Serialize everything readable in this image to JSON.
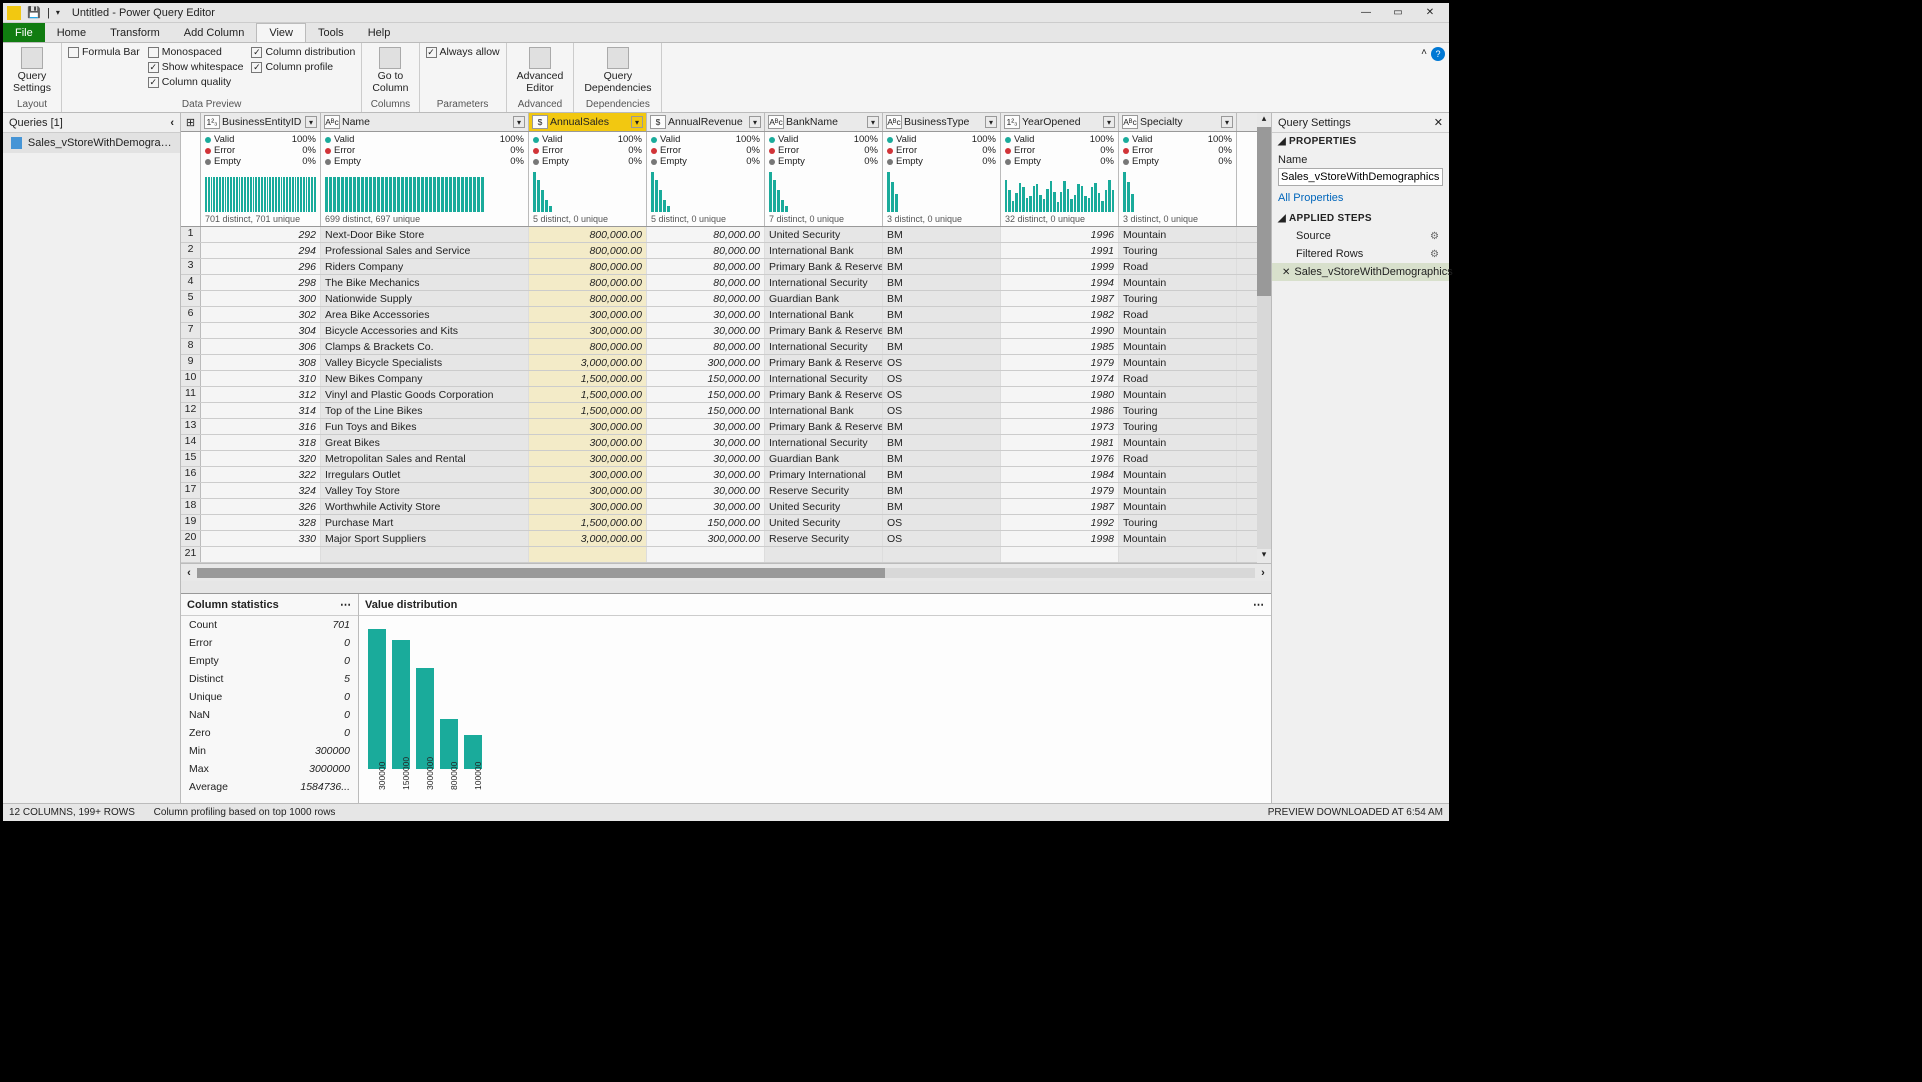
{
  "window": {
    "title": "Untitled - Power Query Editor"
  },
  "menutabs": [
    "File",
    "Home",
    "Transform",
    "Add Column",
    "View",
    "Tools",
    "Help"
  ],
  "menutab_active": "View",
  "ribbon": {
    "query_settings": "Query\nSettings",
    "layout_label": "Layout",
    "formula_bar": "Formula Bar",
    "monospaced": "Monospaced",
    "show_whitespace": "Show whitespace",
    "column_quality": "Column quality",
    "column_distribution": "Column distribution",
    "column_profile": "Column profile",
    "data_preview_label": "Data Preview",
    "goto_column": "Go to\nColumn",
    "columns_label": "Columns",
    "always_allow": "Always allow",
    "parameters_label": "Parameters",
    "advanced_editor": "Advanced\nEditor",
    "advanced_label": "Advanced",
    "query_dependencies": "Query\nDependencies",
    "dependencies_label": "Dependencies"
  },
  "queries": {
    "header": "Queries [1]",
    "items": [
      "Sales_vStoreWithDemographics"
    ]
  },
  "columns": [
    {
      "name": "BusinessEntityID",
      "type": "1²₃",
      "distinct": "701 distinct, 701 unique",
      "spark": "flat"
    },
    {
      "name": "Name",
      "type": "Aᴮc",
      "distinct": "699 distinct, 697 unique",
      "spark": "flat"
    },
    {
      "name": "AnnualSales",
      "type": "$",
      "distinct": "5 distinct, 0 unique",
      "spark": "desc",
      "selected": true
    },
    {
      "name": "AnnualRevenue",
      "type": "$",
      "distinct": "5 distinct, 0 unique",
      "spark": "desc"
    },
    {
      "name": "BankName",
      "type": "Aᴮc",
      "distinct": "7 distinct, 0 unique",
      "spark": "desc"
    },
    {
      "name": "BusinessType",
      "type": "Aᴮc",
      "distinct": "3 distinct, 0 unique",
      "spark": "few"
    },
    {
      "name": "YearOpened",
      "type": "1²₃",
      "distinct": "32 distinct, 0 unique",
      "spark": "spread"
    },
    {
      "name": "Specialty",
      "type": "Aᴮc",
      "distinct": "3 distinct, 0 unique",
      "spark": "few"
    }
  ],
  "profile_stats": {
    "valid": "Valid",
    "valid_pct": "100%",
    "error": "Error",
    "error_pct": "0%",
    "empty": "Empty",
    "empty_pct": "0%"
  },
  "rows": [
    {
      "n": 1,
      "id": "292",
      "name": "Next-Door Bike Store",
      "sales": "800,000.00",
      "rev": "80,000.00",
      "bank": "United Security",
      "bt": "BM",
      "yr": "1996",
      "sp": "Mountain"
    },
    {
      "n": 2,
      "id": "294",
      "name": "Professional Sales and Service",
      "sales": "800,000.00",
      "rev": "80,000.00",
      "bank": "International Bank",
      "bt": "BM",
      "yr": "1991",
      "sp": "Touring"
    },
    {
      "n": 3,
      "id": "296",
      "name": "Riders Company",
      "sales": "800,000.00",
      "rev": "80,000.00",
      "bank": "Primary Bank & Reserve",
      "bt": "BM",
      "yr": "1999",
      "sp": "Road"
    },
    {
      "n": 4,
      "id": "298",
      "name": "The Bike Mechanics",
      "sales": "800,000.00",
      "rev": "80,000.00",
      "bank": "International Security",
      "bt": "BM",
      "yr": "1994",
      "sp": "Mountain"
    },
    {
      "n": 5,
      "id": "300",
      "name": "Nationwide Supply",
      "sales": "800,000.00",
      "rev": "80,000.00",
      "bank": "Guardian Bank",
      "bt": "BM",
      "yr": "1987",
      "sp": "Touring"
    },
    {
      "n": 6,
      "id": "302",
      "name": "Area Bike Accessories",
      "sales": "300,000.00",
      "rev": "30,000.00",
      "bank": "International Bank",
      "bt": "BM",
      "yr": "1982",
      "sp": "Road"
    },
    {
      "n": 7,
      "id": "304",
      "name": "Bicycle Accessories and Kits",
      "sales": "300,000.00",
      "rev": "30,000.00",
      "bank": "Primary Bank & Reserve",
      "bt": "BM",
      "yr": "1990",
      "sp": "Mountain"
    },
    {
      "n": 8,
      "id": "306",
      "name": "Clamps & Brackets Co.",
      "sales": "800,000.00",
      "rev": "80,000.00",
      "bank": "International Security",
      "bt": "BM",
      "yr": "1985",
      "sp": "Mountain"
    },
    {
      "n": 9,
      "id": "308",
      "name": "Valley Bicycle Specialists",
      "sales": "3,000,000.00",
      "rev": "300,000.00",
      "bank": "Primary Bank & Reserve",
      "bt": "OS",
      "yr": "1979",
      "sp": "Mountain"
    },
    {
      "n": 10,
      "id": "310",
      "name": "New Bikes Company",
      "sales": "1,500,000.00",
      "rev": "150,000.00",
      "bank": "International Security",
      "bt": "OS",
      "yr": "1974",
      "sp": "Road"
    },
    {
      "n": 11,
      "id": "312",
      "name": "Vinyl and Plastic Goods Corporation",
      "sales": "1,500,000.00",
      "rev": "150,000.00",
      "bank": "Primary Bank & Reserve",
      "bt": "OS",
      "yr": "1980",
      "sp": "Mountain"
    },
    {
      "n": 12,
      "id": "314",
      "name": "Top of the Line Bikes",
      "sales": "1,500,000.00",
      "rev": "150,000.00",
      "bank": "International Bank",
      "bt": "OS",
      "yr": "1986",
      "sp": "Touring"
    },
    {
      "n": 13,
      "id": "316",
      "name": "Fun Toys and Bikes",
      "sales": "300,000.00",
      "rev": "30,000.00",
      "bank": "Primary Bank & Reserve",
      "bt": "BM",
      "yr": "1973",
      "sp": "Touring"
    },
    {
      "n": 14,
      "id": "318",
      "name": "Great Bikes",
      "sales": "300,000.00",
      "rev": "30,000.00",
      "bank": "International Security",
      "bt": "BM",
      "yr": "1981",
      "sp": "Mountain"
    },
    {
      "n": 15,
      "id": "320",
      "name": "Metropolitan Sales and Rental",
      "sales": "300,000.00",
      "rev": "30,000.00",
      "bank": "Guardian Bank",
      "bt": "BM",
      "yr": "1976",
      "sp": "Road"
    },
    {
      "n": 16,
      "id": "322",
      "name": "Irregulars Outlet",
      "sales": "300,000.00",
      "rev": "30,000.00",
      "bank": "Primary International",
      "bt": "BM",
      "yr": "1984",
      "sp": "Mountain"
    },
    {
      "n": 17,
      "id": "324",
      "name": "Valley Toy Store",
      "sales": "300,000.00",
      "rev": "30,000.00",
      "bank": "Reserve Security",
      "bt": "BM",
      "yr": "1979",
      "sp": "Mountain"
    },
    {
      "n": 18,
      "id": "326",
      "name": "Worthwhile Activity Store",
      "sales": "300,000.00",
      "rev": "30,000.00",
      "bank": "United Security",
      "bt": "BM",
      "yr": "1987",
      "sp": "Mountain"
    },
    {
      "n": 19,
      "id": "328",
      "name": "Purchase Mart",
      "sales": "1,500,000.00",
      "rev": "150,000.00",
      "bank": "United Security",
      "bt": "OS",
      "yr": "1992",
      "sp": "Touring"
    },
    {
      "n": 20,
      "id": "330",
      "name": "Major Sport Suppliers",
      "sales": "3,000,000.00",
      "rev": "300,000.00",
      "bank": "Reserve Security",
      "bt": "OS",
      "yr": "1998",
      "sp": "Mountain"
    },
    {
      "n": 21,
      "id": "",
      "name": "",
      "sales": "",
      "rev": "",
      "bank": "",
      "bt": "",
      "yr": "",
      "sp": ""
    }
  ],
  "colstats": {
    "title": "Column statistics",
    "rows": [
      {
        "l": "Count",
        "v": "701"
      },
      {
        "l": "Error",
        "v": "0"
      },
      {
        "l": "Empty",
        "v": "0"
      },
      {
        "l": "Distinct",
        "v": "5"
      },
      {
        "l": "Unique",
        "v": "0"
      },
      {
        "l": "NaN",
        "v": "0"
      },
      {
        "l": "Zero",
        "v": "0"
      },
      {
        "l": "Min",
        "v": "300000"
      },
      {
        "l": "Max",
        "v": "3000000"
      },
      {
        "l": "Average",
        "v": "1584736..."
      }
    ]
  },
  "valdist": {
    "title": "Value distribution"
  },
  "chart_data": {
    "type": "bar",
    "categories": [
      "300000",
      "1500000",
      "3000000",
      "800000",
      "100000"
    ],
    "values": [
      250,
      230,
      180,
      90,
      60
    ],
    "title": "Value distribution",
    "xlabel": "",
    "ylabel": ""
  },
  "settings": {
    "title": "Query Settings",
    "properties": "PROPERTIES",
    "name_label": "Name",
    "name_value": "Sales_vStoreWithDemographics",
    "all_properties": "All Properties",
    "applied_steps": "APPLIED STEPS",
    "steps": [
      {
        "name": "Source",
        "gear": true
      },
      {
        "name": "Filtered Rows",
        "gear": true
      },
      {
        "name": "Sales_vStoreWithDemographics",
        "gear": false,
        "selected": true,
        "del": true
      }
    ]
  },
  "statusbar": {
    "cols": "12 COLUMNS, 199+ ROWS",
    "profiling": "Column profiling based on top 1000 rows",
    "preview": "PREVIEW DOWNLOADED AT 6:54 AM"
  }
}
